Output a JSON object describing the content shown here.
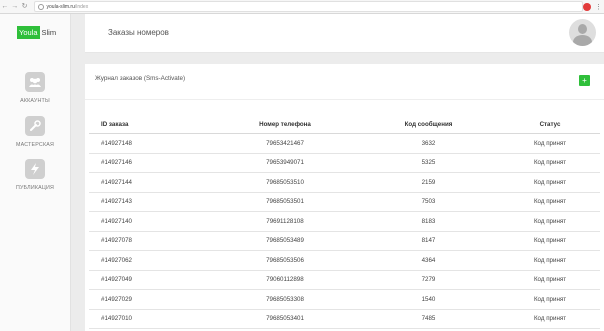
{
  "browser": {
    "back_icon": "←",
    "forward_icon": "→",
    "reload_icon": "↻",
    "url_host": "youla-slim.ru",
    "url_path": "/index",
    "menu_icon": "⋮"
  },
  "logo": {
    "part1": "Youla",
    "part2": "Slim",
    "accent": "#2fbf3a"
  },
  "sidebar": {
    "items": [
      {
        "label": "АККАУНТЫ",
        "icon": "users-icon",
        "glyph": "●"
      },
      {
        "label": "МАСТЕРСКАЯ",
        "icon": "wrench-icon",
        "glyph": "⚒"
      },
      {
        "label": "ПУБЛИКАЦИЯ",
        "icon": "bolt-icon",
        "glyph": "⚡"
      }
    ]
  },
  "header": {
    "title": "Заказы номеров"
  },
  "panel": {
    "title": "Журнал заказов (Sms-Activate)",
    "add_label": "+"
  },
  "table": {
    "columns": [
      "ID заказа",
      "Номер телефона",
      "Код сообщения",
      "Статус"
    ],
    "rows": [
      [
        "#14927148",
        "79653421467",
        "3632",
        "Код принят"
      ],
      [
        "#14927146",
        "79653949071",
        "5325",
        "Код принят"
      ],
      [
        "#14927144",
        "79685053510",
        "2159",
        "Код принят"
      ],
      [
        "#14927143",
        "79685053501",
        "7503",
        "Код принят"
      ],
      [
        "#14927140",
        "79691128108",
        "8183",
        "Код принят"
      ],
      [
        "#14927078",
        "79685053489",
        "8147",
        "Код принят"
      ],
      [
        "#14927062",
        "79685053506",
        "4364",
        "Код принят"
      ],
      [
        "#14927049",
        "79060112898",
        "7279",
        "Код принят"
      ],
      [
        "#14927029",
        "79685053308",
        "1540",
        "Код принят"
      ],
      [
        "#14927010",
        "79685053401",
        "7485",
        "Код принят"
      ]
    ]
  }
}
